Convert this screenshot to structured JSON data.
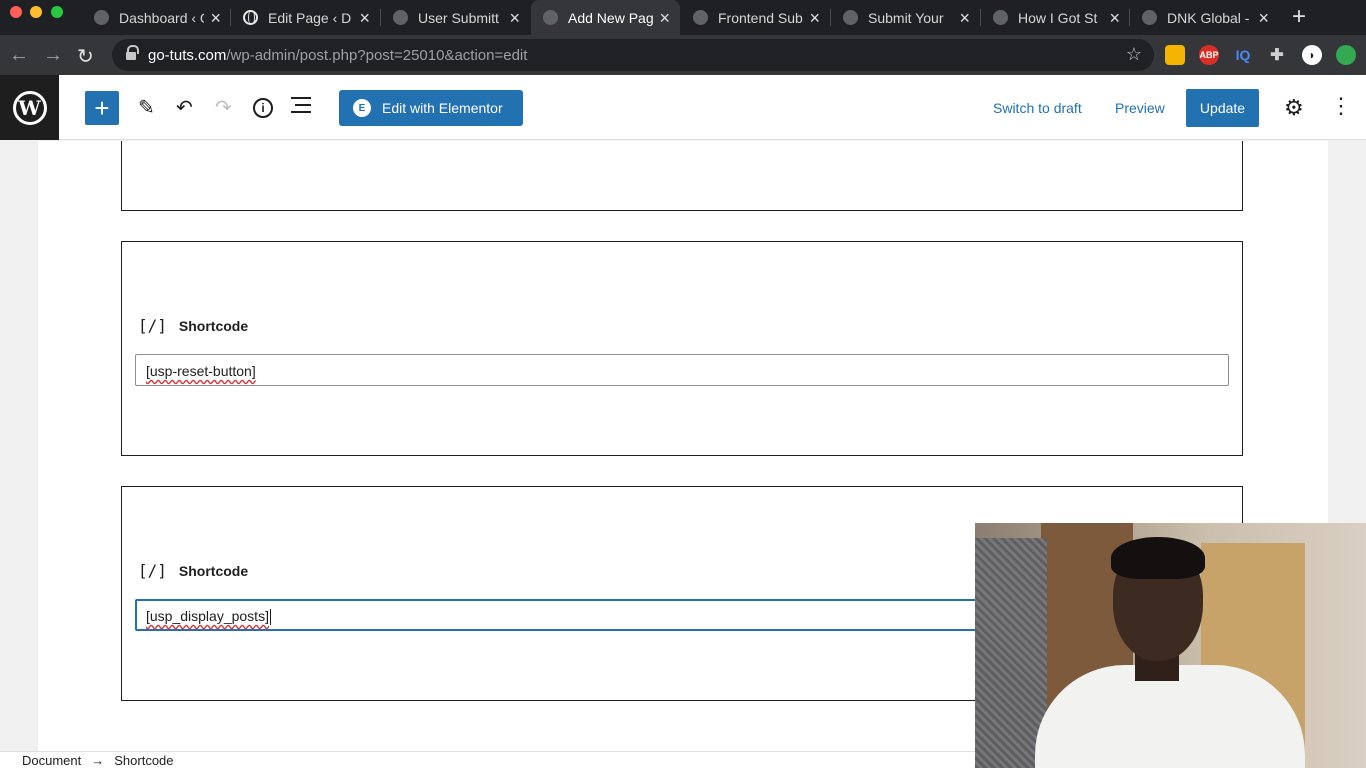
{
  "browser": {
    "tabs": [
      {
        "title": "Dashboard ‹ G",
        "active": false
      },
      {
        "title": "Edit Page ‹ D",
        "active": false
      },
      {
        "title": "User Submitt",
        "active": false
      },
      {
        "title": "Add New Pag",
        "active": true
      },
      {
        "title": "Frontend Sub",
        "active": false
      },
      {
        "title": "Submit Your",
        "active": false
      },
      {
        "title": "How I Got St",
        "active": false
      },
      {
        "title": "DNK Global -",
        "active": false
      }
    ],
    "url_host": "go-tuts.com",
    "url_path": "/wp-admin/post.php?post=25010&action=edit",
    "extensions": {
      "abp": "ABP",
      "iq": "IQ"
    }
  },
  "toolbar": {
    "logo": "W",
    "add_block": "+",
    "elementor_icon": "E",
    "elementor_label": "Edit with Elementor",
    "switch_to_draft": "Switch to draft",
    "preview": "Preview",
    "update": "Update"
  },
  "blocks": [
    {
      "type": "Shortcode",
      "icon": "[/]",
      "value": "[usp-reset-button]",
      "focused": false
    },
    {
      "type": "Shortcode",
      "icon": "[/]",
      "value": "[usp_display_posts]",
      "focused": true
    }
  ],
  "footer": {
    "breadcrumb": [
      "Document",
      "Shortcode"
    ],
    "separator": "→"
  },
  "colors": {
    "wp_blue": "#2271b1",
    "tab_bar": "#1f2023",
    "address_bar": "#35363a"
  }
}
